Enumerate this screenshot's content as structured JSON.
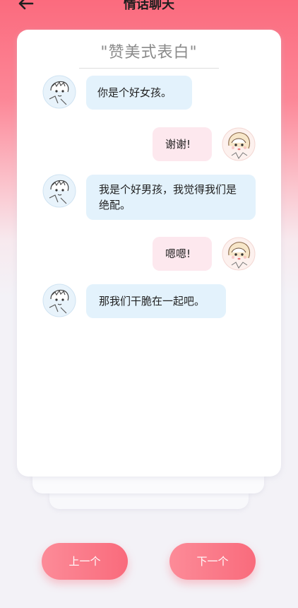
{
  "header": {
    "title": "情话聊天"
  },
  "card": {
    "title": "\"赞美式表白\""
  },
  "messages": [
    {
      "side": "left",
      "speaker": "boy",
      "text": "你是个好女孩。"
    },
    {
      "side": "right",
      "speaker": "girl",
      "text": "谢谢!"
    },
    {
      "side": "left",
      "speaker": "boy",
      "text": "我是个好男孩，我觉得我们是绝配。"
    },
    {
      "side": "right",
      "speaker": "girl",
      "text": "嗯嗯!"
    },
    {
      "side": "left",
      "speaker": "boy",
      "text": "那我们干脆在一起吧。"
    }
  ],
  "buttons": {
    "prev_label": "上一个",
    "next_label": "下一个"
  },
  "colors": {
    "accent": "#f96b7c",
    "bubble_left": "#e3f2fc",
    "bubble_right": "#fde8ee"
  },
  "icons": {
    "back": "arrow-left-icon",
    "boy_avatar": "boy-avatar-icon",
    "girl_avatar": "girl-avatar-icon"
  }
}
